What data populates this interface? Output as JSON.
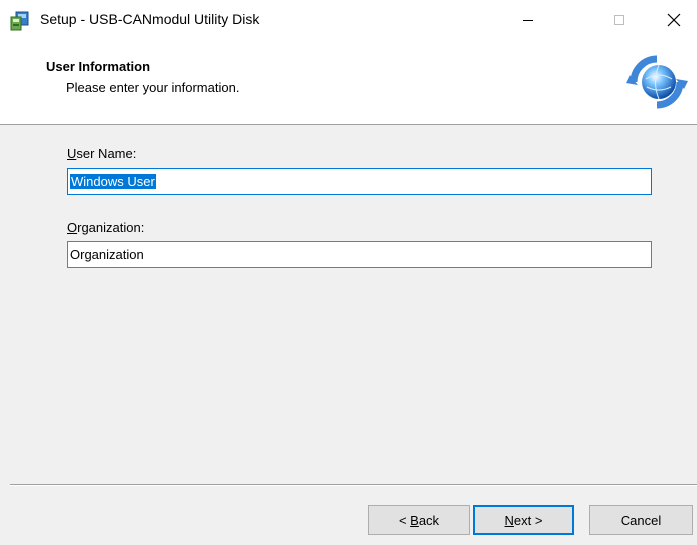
{
  "window": {
    "title": "Setup - USB-CANmodul Utility Disk",
    "icon": "setup-installer-icon",
    "controls": {
      "minimize": "minimize-icon",
      "maximize": "maximize-icon",
      "close": "close-icon"
    }
  },
  "header": {
    "title": "User Information",
    "subtitle": "Please enter your information.",
    "image": "wizard-globe-icon"
  },
  "form": {
    "user_name": {
      "label_mnemonic": "U",
      "label_rest": "ser Name:",
      "value": "Windows User",
      "state": "focused, text selected"
    },
    "organization": {
      "label_mnemonic": "O",
      "label_rest": "rganization:",
      "value": "Organization"
    }
  },
  "buttons": {
    "back": {
      "prefix": "< ",
      "mnemonic": "B",
      "rest": "ack"
    },
    "next": {
      "mnemonic": "N",
      "rest": "ext >",
      "is_default": true
    },
    "cancel": {
      "label": "Cancel"
    }
  },
  "colors": {
    "accent": "#0078d7",
    "selection": "#0078d7",
    "dialog_bg": "#f0f0f0",
    "header_bg": "#ffffff"
  }
}
